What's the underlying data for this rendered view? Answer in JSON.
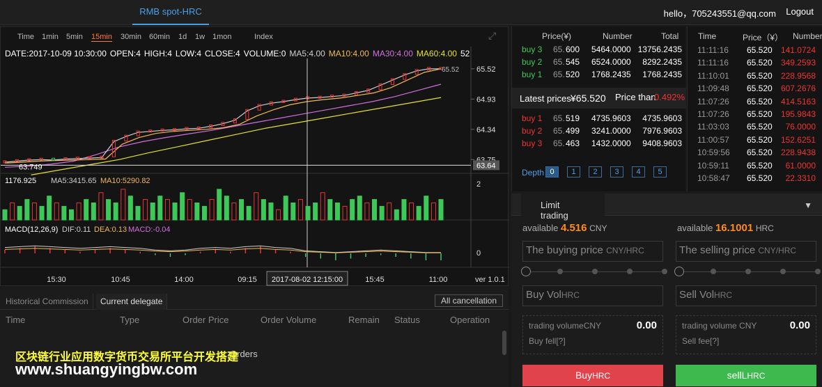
{
  "header": {
    "tab": "RMB spot-HRC",
    "user": "hello，705243551@qq.com",
    "logout": "Logout"
  },
  "chart": {
    "periods": [
      "Time",
      "1min",
      "5min",
      "15min",
      "30min",
      "60min",
      "1d",
      "1w",
      "1mon",
      "Index"
    ],
    "active_period": "15min",
    "info": {
      "date": "DATE:2017-10-09 10:30:00",
      "open": "OPEN:4",
      "high": "HIGH:4",
      "low": "LOW:4",
      "close": "CLOSE:4",
      "volume": "VOLUME:0",
      "ma5": "MA5:4.00",
      "ma10": "MA10:4.00",
      "ma30": "MA30:4.00",
      "ma60": "MA60:4.00",
      "tail": "52"
    },
    "price_ticks": [
      "65.52",
      "64.93",
      "64.34",
      "63.75"
    ],
    "current_price_tag": "63.64",
    "low_marker": "63.749",
    "high_marker": "65.52",
    "volume_info": {
      "max": "1176.925",
      "ma5": "MA5:3415.65",
      "ma10": "MA10:5290.82"
    },
    "volume_tick": "2",
    "macd_info": {
      "label": "MACD(12,26,9)",
      "dif": "DIF:0.11",
      "dea": "DEA:0.13",
      "macd": "MACD:-0.04"
    },
    "macd_tick": "0",
    "time_labels": [
      "15:30",
      "10:45",
      "14:00",
      "09:15",
      "15:45",
      "11:00"
    ],
    "crosshair_time": "2017-08-02 12:15:00",
    "version": "ver 1.0.1",
    "colors": {
      "ma5": "#cfcfcf",
      "ma10": "#f0b85a",
      "ma30": "#d36ee0",
      "ma60": "#e6e030",
      "up": "#e33",
      "down": "#3fc85a"
    },
    "chart_data": {
      "type": "candlestick",
      "price_series": [
        63.7,
        63.72,
        63.74,
        63.75,
        63.74,
        63.76,
        63.77,
        63.78,
        63.79,
        64.1,
        64.2,
        64.28,
        64.3,
        64.32,
        64.33,
        64.35,
        64.36,
        64.4,
        64.45,
        64.52,
        64.7,
        64.8,
        64.85,
        64.88,
        64.92,
        64.95,
        64.96,
        64.98,
        65.0,
        65.05,
        65.1,
        65.2,
        65.3,
        65.4,
        65.48,
        65.52,
        65.52
      ],
      "ma10": [
        63.68,
        63.7,
        63.72,
        63.73,
        63.74,
        63.75,
        63.76,
        64.05,
        64.18,
        64.26,
        64.3,
        64.32,
        64.34,
        64.37,
        64.44,
        64.6,
        64.72,
        64.82,
        64.88,
        64.92,
        64.95,
        65.0,
        65.05,
        65.15,
        65.3,
        65.45,
        65.52
      ],
      "ma30": [
        63.6,
        63.62,
        63.66,
        63.72,
        63.85,
        64.0,
        64.1,
        64.18,
        64.25,
        64.32,
        64.4,
        64.48,
        64.56,
        64.64,
        64.72,
        64.8,
        64.88,
        64.98,
        65.1,
        65.22
      ],
      "ma60": [
        63.45,
        63.55,
        63.65,
        63.75,
        63.88,
        64.0,
        64.12,
        64.24,
        64.36,
        64.46,
        64.56,
        64.66,
        64.76,
        64.86,
        64.96
      ],
      "volume": [
        0.3,
        0.5,
        0.4,
        0.6,
        0.5,
        0.4,
        0.7,
        0.5,
        0.4,
        0.3,
        0.5,
        0.6,
        0.5,
        0.8,
        0.6,
        0.5,
        0.9,
        0.7,
        0.4,
        0.6,
        0.5,
        0.7,
        0.6,
        0.5,
        0.8,
        0.6,
        0.5,
        0.4,
        0.6,
        0.9,
        0.7,
        0.5,
        0.6,
        0.4,
        0.8,
        0.6,
        0.5,
        0.3,
        0.7,
        0.5,
        0.6,
        0.4,
        0.5,
        0.8,
        0.6,
        0.5,
        0.4,
        0.6,
        0.7,
        0.5,
        0.6,
        0.4,
        0.5,
        0.3,
        0.6,
        0.5,
        0.4,
        0.7,
        0.5,
        0.6
      ],
      "macd": [
        0.02,
        0.03,
        0.04,
        0.03,
        0.02,
        0.01,
        0.02,
        0.03,
        0.02,
        0.01,
        -0.01,
        -0.02,
        -0.01,
        0.01,
        0.02,
        0.01,
        0.03,
        0.04,
        0.02,
        0.01,
        -0.02,
        -0.03,
        -0.04,
        -0.03,
        -0.02,
        -0.01,
        -0.02,
        -0.03,
        -0.04,
        -0.04
      ]
    }
  },
  "lower": {
    "tabs": [
      "Historical Commission",
      "Current delegate"
    ],
    "cancel_all": "All cancellation",
    "headers": [
      "Time",
      "Type",
      "Order Price",
      "Order Volume",
      "Remain",
      "Status",
      "Operation"
    ],
    "empty": "Orders",
    "watermark1": "区块链行业应用数字货币交易所平台开发搭建",
    "watermark2": "www.shuangyingbw.com"
  },
  "book": {
    "headers": [
      "Price(¥)",
      "Number",
      "Total"
    ],
    "sells": [
      {
        "label": "buy 3",
        "p1": "65.",
        "p2": "600",
        "n": "5464.0000",
        "t": "13756.2435"
      },
      {
        "label": "buy 2",
        "p1": "65.",
        "p2": "545",
        "n": "6524.0000",
        "t": "8292.2435"
      },
      {
        "label": "buy 1",
        "p1": "65.",
        "p2": "520",
        "n": "1768.2435",
        "t": "1768.2435"
      }
    ],
    "latest_label": "Latest prices",
    "latest_value": "¥65.520",
    "price_than_label": "Price than",
    "price_than_value": "0.492%",
    "buys": [
      {
        "label": "buy 1",
        "p1": "65.",
        "p2": "519",
        "n": "4735.9603",
        "t": "4735.9603"
      },
      {
        "label": "buy 2",
        "p1": "65.",
        "p2": "499",
        "n": "3241.0000",
        "t": "7976.9603"
      },
      {
        "label": "buy 3",
        "p1": "65.",
        "p2": "463",
        "n": "1432.0000",
        "t": "9408.9603"
      }
    ],
    "depth_label": "Depth",
    "depth_btns": [
      "0",
      "1",
      "2",
      "3",
      "4",
      "5"
    ]
  },
  "trades": {
    "headers": [
      "Time",
      "Price（¥）",
      "Number"
    ],
    "rows": [
      {
        "t": "11:11:16",
        "p": "65.520",
        "n": "141.0724"
      },
      {
        "t": "11:11:16",
        "p": "65.520",
        "n": "349.2593"
      },
      {
        "t": "11:10:01",
        "p": "65.520",
        "n": "228.9568"
      },
      {
        "t": "11:09:48",
        "p": "65.520",
        "n": "607.2676"
      },
      {
        "t": "11:07:26",
        "p": "65.520",
        "n": "414.5163"
      },
      {
        "t": "11:07:26",
        "p": "65.520",
        "n": "195.9843"
      },
      {
        "t": "11:03:03",
        "p": "65.520",
        "n": "76.0000"
      },
      {
        "t": "11:00:57",
        "p": "65.520",
        "n": "152.6251"
      },
      {
        "t": "10:59:56",
        "p": "65.520",
        "n": "228.9438"
      },
      {
        "t": "10:59:11",
        "p": "65.520",
        "n": "61.0000"
      },
      {
        "t": "10:58:47",
        "p": "65.520",
        "n": "22.3310"
      }
    ]
  },
  "trade": {
    "tab": "Limit trading",
    "avail_buy_label": "available",
    "avail_buy_val": "4.516",
    "avail_buy_unit": "CNY",
    "avail_sell_label": "available",
    "avail_sell_val": "16.1001",
    "avail_sell_unit": "HRC",
    "buy_price": "The buying price",
    "buy_price_unit": "CNY/HRC",
    "sell_price": "The selling price",
    "sell_price_unit": "CNY/HRC",
    "buy_vol": "Buy Vol",
    "buy_vol_unit": "HRC",
    "sell_vol": "Sell Vol",
    "sell_vol_unit": "HRC",
    "buy_tv_label": "trading volumeCNY",
    "buy_tv_val": "0.00",
    "buy_fee": "Buy fell[?]",
    "sell_tv_label": "trading volume CNY",
    "sell_tv_val": "0.00",
    "sell_fee": "Sell fee[?]",
    "buy_btn": "Buy",
    "buy_btn_unit": "HRC",
    "sell_btn": "sellL",
    "sell_btn_unit": "HRC"
  }
}
